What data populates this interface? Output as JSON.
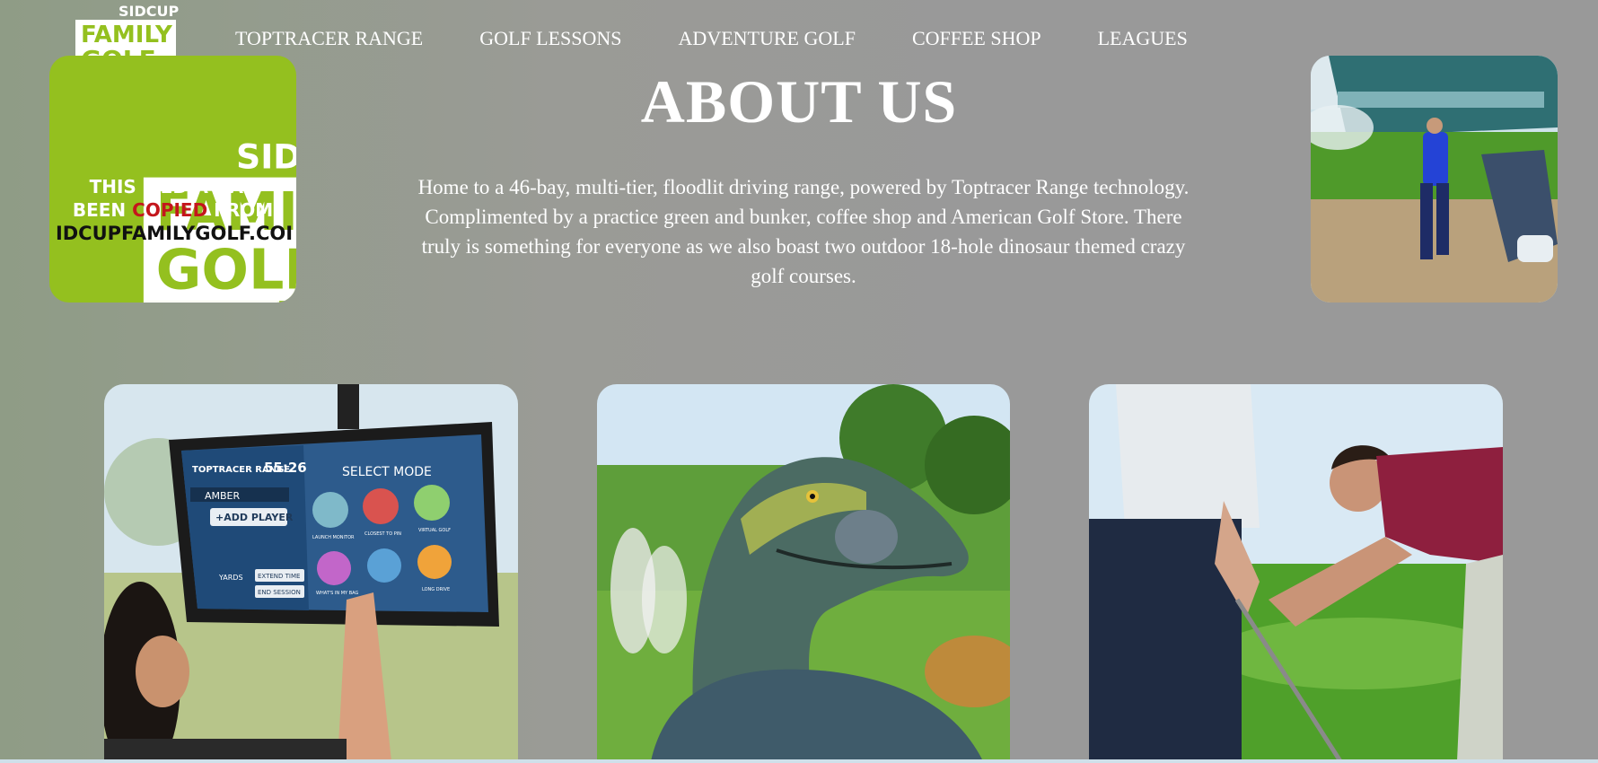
{
  "brand": {
    "top": "SIDCUP",
    "line1": "FAMILY",
    "line2": "GOLF",
    "colors": {
      "green": "#94c01f",
      "white": "#ffffff"
    }
  },
  "nav": {
    "items": [
      {
        "label": "TOPTRACER RANGE"
      },
      {
        "label": "GOLF LESSONS"
      },
      {
        "label": "ADVENTURE GOLF"
      },
      {
        "label": "COFFEE SHOP"
      },
      {
        "label": "LEAGUES"
      }
    ]
  },
  "main": {
    "title": "ABOUT US",
    "description": "Home to a 46-bay, multi-tier, floodlit driving range, powered by Toptracer Range technology. Complimented by a practice green and bunker, coffee shop and American Golf Store. There truly is something for everyone as we also boast two outdoor 18-hole dinosaur themed crazy golf courses."
  },
  "watermark": {
    "line1": "THIS MEDIA HAS",
    "line2_a": "BEEN ",
    "line2_copied": "COPIED",
    "line2_b": " FROM",
    "url": "IDCUPFAMILYGOLF.COI"
  },
  "toptracer_screen": {
    "brand": "TOPTRACER RANGE",
    "timer": "55:26",
    "mode_title": "SELECT MODE",
    "player": "AMBER",
    "add_player": "+ADD PLAYER",
    "yards": "YARDS",
    "extend": "EXTEND TIME",
    "end": "END SESSION",
    "modes": [
      "LAUNCH MONITOR",
      "CLOSEST TO PIN",
      "VIRTUAL GOLF",
      "WHAT'S IN MY BAG",
      "",
      "LONG DRIVE"
    ]
  },
  "colors": {
    "page_bg": "#999999",
    "accent_green": "#94c01f",
    "copied_red": "#c4161c"
  }
}
